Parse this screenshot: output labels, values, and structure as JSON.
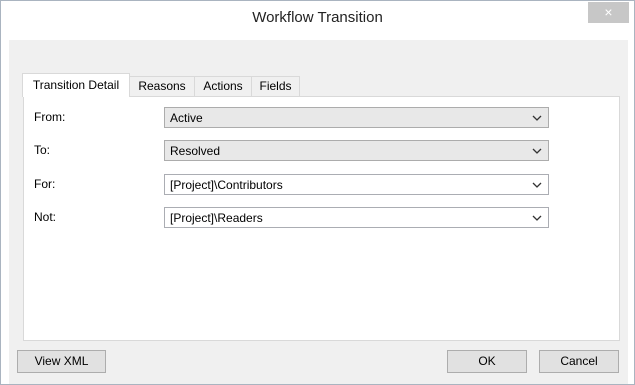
{
  "window": {
    "title": "Workflow Transition",
    "close_glyph": "×"
  },
  "tabs": [
    {
      "label": "Transition Detail",
      "active": true
    },
    {
      "label": "Reasons",
      "active": false
    },
    {
      "label": "Actions",
      "active": false
    },
    {
      "label": "Fields",
      "active": false
    }
  ],
  "form": {
    "rows": [
      {
        "label": "From:",
        "value": "Active",
        "editable": false
      },
      {
        "label": "To:",
        "value": "Resolved",
        "editable": false
      },
      {
        "label": "For:",
        "value": "[Project]\\Contributors",
        "editable": true
      },
      {
        "label": "Not:",
        "value": "[Project]\\Readers",
        "editable": true
      }
    ]
  },
  "buttons": {
    "view_xml": "View XML",
    "ok": "OK",
    "cancel": "Cancel"
  },
  "icons": {
    "close": "close-icon",
    "dropdown": "chevron-down-icon"
  },
  "colors": {
    "dialog_bg": "#f0f0f0",
    "close_button_bg": "#c7c7c7",
    "button_bg": "#e1e1e1"
  }
}
